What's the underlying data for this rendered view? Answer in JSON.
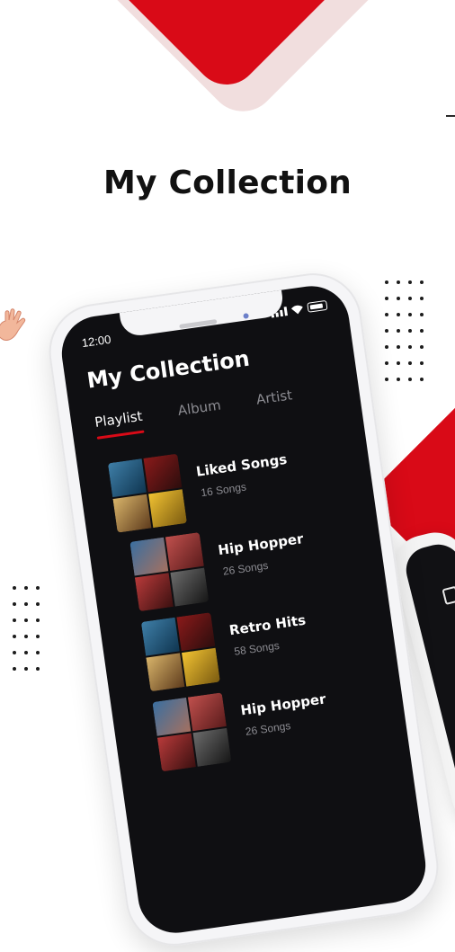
{
  "headline": "My Collection",
  "colors": {
    "accent": "#d90a17",
    "screen_bg": "#0f0f12",
    "muted_text": "#8c8c92"
  },
  "phone": {
    "status_time": "12:00",
    "title": "My Collection",
    "tabs": [
      {
        "label": "Playlist",
        "active": true
      },
      {
        "label": "Album",
        "active": false
      },
      {
        "label": "Artist",
        "active": false
      }
    ],
    "playlists": [
      {
        "name": "Liked Songs",
        "count": "16 Songs"
      },
      {
        "name": "Hip Hopper",
        "count": "26 Songs"
      },
      {
        "name": "Retro Hits",
        "count": "58 Songs"
      },
      {
        "name": "Hip Hopper",
        "count": "26 Songs"
      }
    ]
  },
  "icons": {
    "status": [
      "signal-icon",
      "wifi-icon",
      "battery-icon"
    ],
    "decorative": [
      "hand-icon"
    ]
  }
}
